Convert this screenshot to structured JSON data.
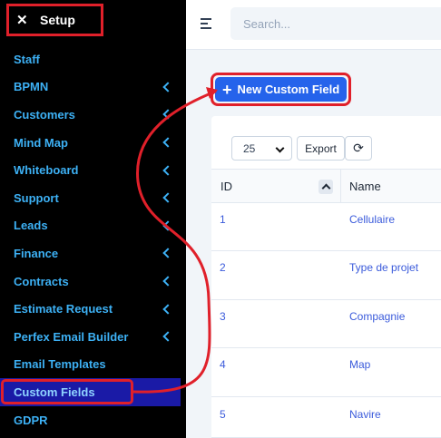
{
  "sidebar": {
    "header": {
      "close_glyph": "✕",
      "title": "Setup"
    },
    "items": [
      {
        "label": "Staff",
        "has_submenu": false
      },
      {
        "label": "BPMN",
        "has_submenu": true
      },
      {
        "label": "Customers",
        "has_submenu": true
      },
      {
        "label": "Mind Map",
        "has_submenu": true
      },
      {
        "label": "Whiteboard",
        "has_submenu": true
      },
      {
        "label": "Support",
        "has_submenu": true
      },
      {
        "label": "Leads",
        "has_submenu": true
      },
      {
        "label": "Finance",
        "has_submenu": true
      },
      {
        "label": "Contracts",
        "has_submenu": true
      },
      {
        "label": "Estimate Request",
        "has_submenu": true
      },
      {
        "label": "Perfex Email Builder",
        "has_submenu": true
      },
      {
        "label": "Email Templates",
        "has_submenu": false
      },
      {
        "label": "Custom Fields",
        "has_submenu": false,
        "active": true
      },
      {
        "label": "GDPR",
        "has_submenu": false
      }
    ]
  },
  "topbar": {
    "search_placeholder": "Search..."
  },
  "actions": {
    "new_button_label": "New Custom Field",
    "new_button_plus": "+"
  },
  "table": {
    "page_length": "25",
    "export_label": "Export",
    "refresh_glyph": "⟳",
    "columns": {
      "id": "ID",
      "name": "Name"
    },
    "rows": [
      {
        "id": "1",
        "name": "Cellulaire"
      },
      {
        "id": "2",
        "name": "Type de projet"
      },
      {
        "id": "3",
        "name": "Compagnie"
      },
      {
        "id": "4",
        "name": "Map"
      },
      {
        "id": "5",
        "name": "Navire"
      }
    ]
  },
  "colors": {
    "sidebar_bg": "#000000",
    "sidebar_text": "#3db1f5",
    "active_item_bg": "#1a1aa6",
    "highlight_red": "#e0202a",
    "primary_button": "#2563eb",
    "link_text": "#3b5bdb"
  }
}
